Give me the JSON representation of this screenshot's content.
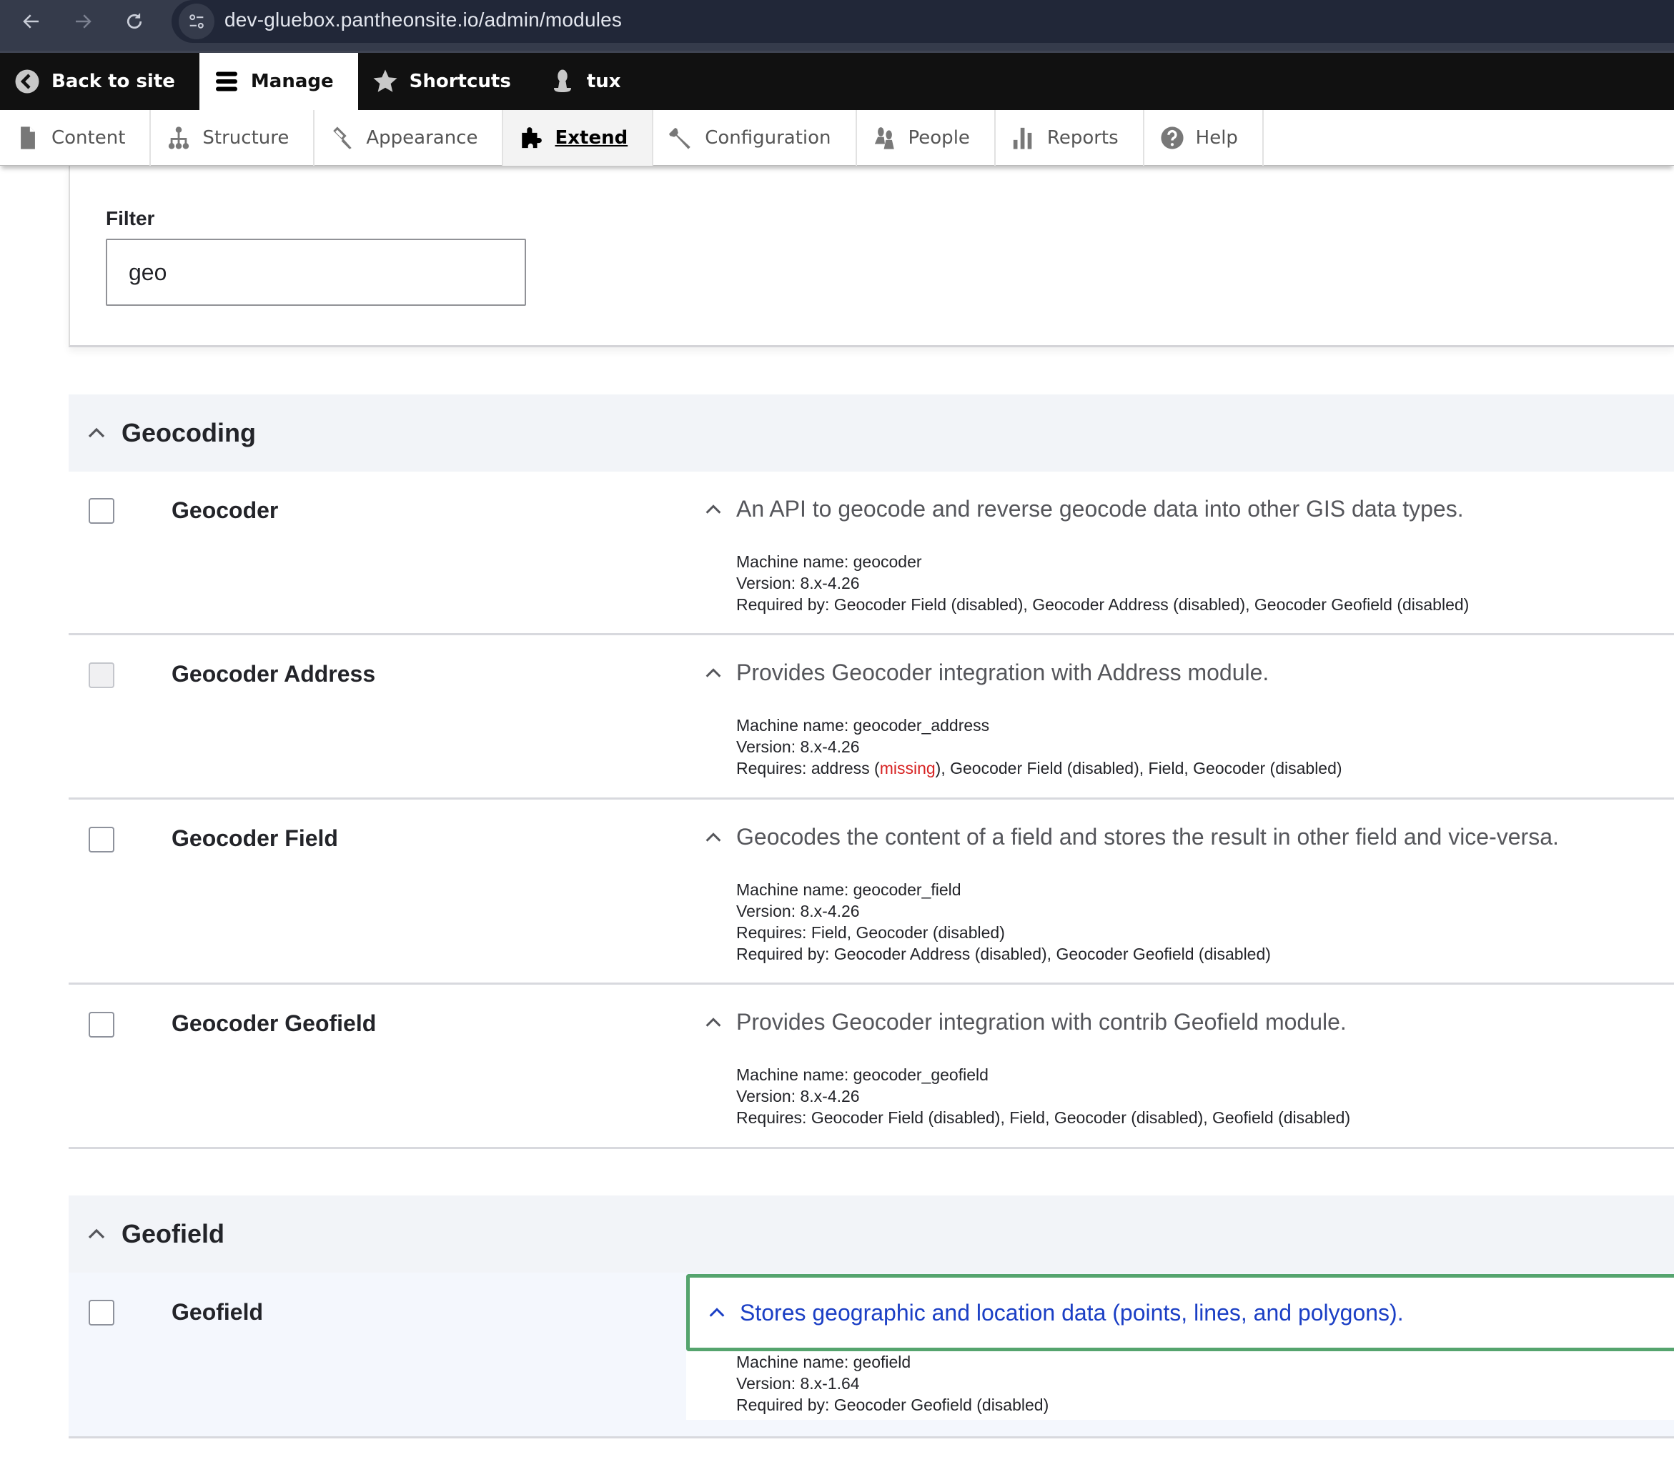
{
  "browser": {
    "url": "dev-gluebox.pantheonsite.io/admin/modules",
    "icons": [
      "back-arrow-icon",
      "forward-arrow-icon",
      "reload-icon",
      "site-info-icon"
    ]
  },
  "toolbar": {
    "items": [
      {
        "label": "Back to site",
        "icon": "back-circle-icon",
        "active": false
      },
      {
        "label": "Manage",
        "icon": "hamburger-icon",
        "active": true
      },
      {
        "label": "Shortcuts",
        "icon": "star-icon",
        "active": false
      },
      {
        "label": "tux",
        "icon": "user-icon",
        "active": false
      }
    ]
  },
  "tray": {
    "items": [
      {
        "label": "Content",
        "icon": "file-icon"
      },
      {
        "label": "Structure",
        "icon": "sitemap-icon"
      },
      {
        "label": "Appearance",
        "icon": "paintbrush-icon"
      },
      {
        "label": "Extend",
        "icon": "puzzle-icon",
        "active": true
      },
      {
        "label": "Configuration",
        "icon": "wrench-icon"
      },
      {
        "label": "People",
        "icon": "people-icon"
      },
      {
        "label": "Reports",
        "icon": "bar-chart-icon"
      },
      {
        "label": "Help",
        "icon": "help-icon"
      }
    ]
  },
  "filter": {
    "label": "Filter",
    "value": "geo"
  },
  "packages": [
    {
      "title": "Geocoding",
      "modules": [
        {
          "name": "Geocoder",
          "checked": false,
          "disabled": false,
          "description": "An API to geocode and reverse geocode data into other GIS data types.",
          "machine_name": "Machine name: geocoder",
          "version": "Version: 8.x-4.26",
          "required_by": "Required by: Geocoder Field (disabled), Geocoder Address (disabled), Geocoder Geofield (disabled)"
        },
        {
          "name": "Geocoder Address",
          "checked": false,
          "disabled": true,
          "description": "Provides Geocoder integration with Address module.",
          "machine_name": "Machine name: geocoder_address",
          "version": "Version: 8.x-4.26",
          "requires_prefix": "Requires: address (",
          "requires_missing": "missing",
          "requires_suffix": "), Geocoder Field (disabled), Field, Geocoder (disabled)"
        },
        {
          "name": "Geocoder Field",
          "checked": false,
          "disabled": false,
          "description": "Geocodes the content of a field and stores the result in other field and vice-versa.",
          "machine_name": "Machine name: geocoder_field",
          "version": "Version: 8.x-4.26",
          "requires": "Requires: Field, Geocoder (disabled)",
          "required_by": "Required by: Geocoder Address (disabled), Geocoder Geofield (disabled)"
        },
        {
          "name": "Geocoder Geofield",
          "checked": false,
          "disabled": false,
          "description": "Provides Geocoder integration with contrib Geofield module.",
          "machine_name": "Machine name: geocoder_geofield",
          "version": "Version: 8.x-4.26",
          "requires": "Requires: Geocoder Field (disabled), Field, Geocoder (disabled), Geofield (disabled)"
        }
      ]
    },
    {
      "title": "Geofield",
      "modules": [
        {
          "name": "Geofield",
          "checked": false,
          "disabled": false,
          "focused": true,
          "description": "Stores geographic and location data (points, lines, and polygons).",
          "machine_name": "Machine name: geofield",
          "version": "Version: 8.x-1.64",
          "required_by": "Required by: Geocoder Geofield (disabled)"
        }
      ]
    }
  ],
  "colors": {
    "focus_outline": "#55a46e",
    "link_blue": "#1b3fc5",
    "missing_red": "#d72222",
    "toolbar_black": "#111111",
    "package_header_bg": "#f2f4f8"
  }
}
